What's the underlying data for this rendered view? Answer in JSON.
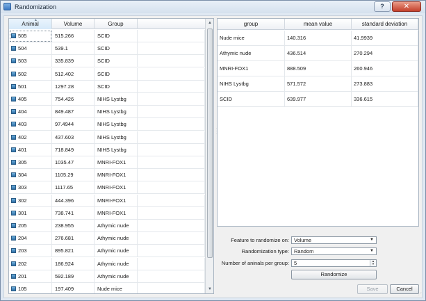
{
  "window": {
    "title": "Randomization",
    "help_label": "?",
    "close_label": "✕",
    "icon": "app-window-icon"
  },
  "animals_table": {
    "headers": [
      "Animal",
      "Volume",
      "Group"
    ],
    "sorted_column": "Animal",
    "rows": [
      {
        "animal": "505",
        "volume": "515.266",
        "group": "SCID"
      },
      {
        "animal": "504",
        "volume": "539.1",
        "group": "SCID"
      },
      {
        "animal": "503",
        "volume": "335.839",
        "group": "SCID"
      },
      {
        "animal": "502",
        "volume": "512.402",
        "group": "SCID"
      },
      {
        "animal": "501",
        "volume": "1297.28",
        "group": "SCID"
      },
      {
        "animal": "405",
        "volume": "754.426",
        "group": "NIHS Lystbg"
      },
      {
        "animal": "404",
        "volume": "849.487",
        "group": "NIHS Lystbg"
      },
      {
        "animal": "403",
        "volume": "97.4944",
        "group": "NIHS Lystbg"
      },
      {
        "animal": "402",
        "volume": "437.603",
        "group": "NIHS Lystbg"
      },
      {
        "animal": "401",
        "volume": "718.849",
        "group": "NIHS Lystbg"
      },
      {
        "animal": "305",
        "volume": "1035.47",
        "group": "MNRI-FOX1"
      },
      {
        "animal": "304",
        "volume": "1105.29",
        "group": "MNRI-FOX1"
      },
      {
        "animal": "303",
        "volume": "1117.65",
        "group": "MNRI-FOX1"
      },
      {
        "animal": "302",
        "volume": "444.396",
        "group": "MNRI-FOX1"
      },
      {
        "animal": "301",
        "volume": "738.741",
        "group": "MNRI-FOX1"
      },
      {
        "animal": "205",
        "volume": "238.955",
        "group": "Athymic nude"
      },
      {
        "animal": "204",
        "volume": "276.681",
        "group": "Athymic nude"
      },
      {
        "animal": "203",
        "volume": "895.821",
        "group": "Athymic nude"
      },
      {
        "animal": "202",
        "volume": "186.924",
        "group": "Athymic nude"
      },
      {
        "animal": "201",
        "volume": "592.189",
        "group": "Athymic nude"
      },
      {
        "animal": "105",
        "volume": "197.409",
        "group": "Nude mice"
      }
    ]
  },
  "stats_table": {
    "headers": [
      "group",
      "mean value",
      "standard deviation"
    ],
    "rows": [
      {
        "group": "Nude mice",
        "mean": "140.316",
        "sd": "41.9939"
      },
      {
        "group": "Athymic nude",
        "mean": "436.514",
        "sd": "270.294"
      },
      {
        "group": "MNRI-FOX1",
        "mean": "888.509",
        "sd": "260.946"
      },
      {
        "group": "NIHS Lystbg",
        "mean": "571.572",
        "sd": "273.883"
      },
      {
        "group": "SCID",
        "mean": "639.977",
        "sd": "336.615"
      }
    ]
  },
  "controls": {
    "feature_label": "Feature to randomize on:",
    "feature_value": "Volume",
    "type_label": "Randomization type:",
    "type_value": "Random",
    "count_label": "Number of aninals per group:",
    "count_value": "5",
    "randomize_label": "Randomize",
    "save_label": "Save",
    "cancel_label": "Cancel"
  },
  "colors": {
    "title_bar": "#d5e1ee",
    "close_button": "#c4402b",
    "row_icon": "#2f6fa5"
  }
}
